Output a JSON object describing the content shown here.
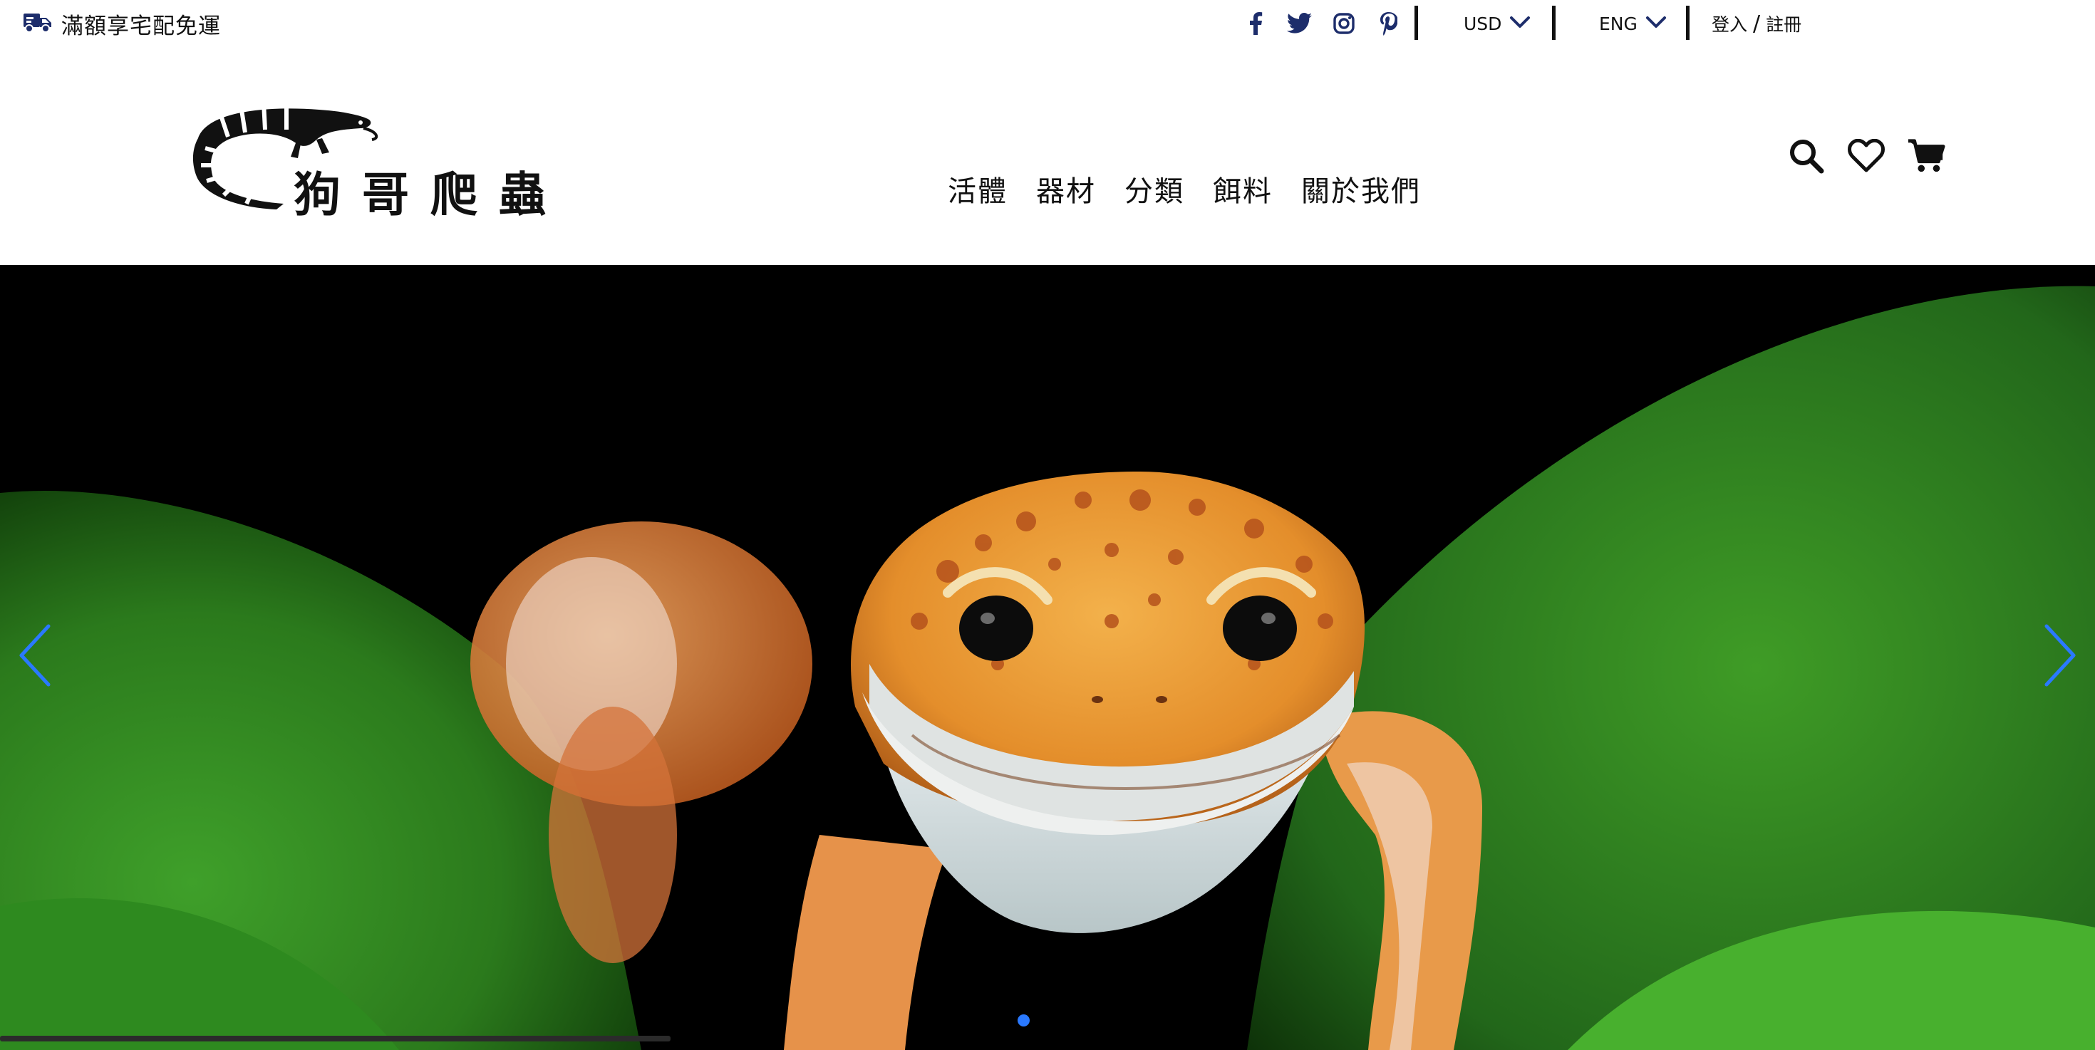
{
  "topbar": {
    "promo_text": "滿額享宅配免運",
    "promo_icon": "truck-icon",
    "social_icons": [
      "facebook-icon",
      "twitter-icon",
      "instagram-icon",
      "pinterest-icon"
    ],
    "currency": "USD",
    "language": "ENG",
    "login_label": "登入",
    "register_label": "註冊"
  },
  "header": {
    "logo_text": "狗哥爬蟲",
    "nav": [
      "活體",
      "器材",
      "分類",
      "餌料",
      "關於我們"
    ],
    "tools": [
      "search-icon",
      "heart-icon",
      "cart-icon"
    ]
  },
  "hero": {
    "slide_count": 1,
    "active_slide": 1,
    "progress": 0.32
  },
  "colors": {
    "accent": "#2a79ff",
    "icon_navy": "#1d2d6b",
    "text": "#111111"
  }
}
